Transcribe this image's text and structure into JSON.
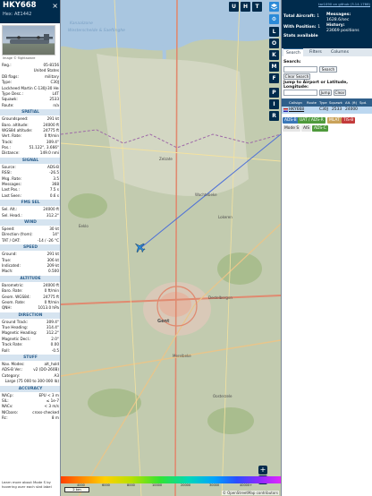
{
  "aircraft": {
    "callsign": "HKY668",
    "hex": "Hex: AE1442",
    "photo_credit": "Image © flightaware",
    "close": "×"
  },
  "basic": [
    {
      "k": "Reg.:",
      "v": "05-8156"
    },
    {
      "k": "",
      "v": "United States"
    },
    {
      "k": "DB flags:",
      "v": "military"
    },
    {
      "k": "Type:",
      "v": "C30J"
    },
    {
      "k": "",
      "v": "Lockheed Martin C-130J-30 Hercules"
    },
    {
      "k": "Type Desc.:",
      "v": "L4T"
    },
    {
      "k": "Squawk:",
      "v": "2533"
    },
    {
      "k": "Route:",
      "v": "n/a"
    }
  ],
  "sections": [
    {
      "title": "SPATIAL",
      "rows": [
        {
          "k": "Groundspeed:",
          "v": "291 kt"
        },
        {
          "k": "Baro. altitude:",
          "v": "24000 ft"
        },
        {
          "k": "WGS84 altitude:",
          "v": "24775 ft"
        },
        {
          "k": "Vert. Rate:",
          "v": "0 ft/min"
        },
        {
          "k": "Track:",
          "v": "309.4°"
        },
        {
          "k": "Pos.:",
          "v": "51.122°, 3.666°"
        },
        {
          "k": "Distance:",
          "v": "149.0 nmi"
        }
      ]
    },
    {
      "title": "SIGNAL",
      "rows": [
        {
          "k": "Source:",
          "v": "ADS-B"
        },
        {
          "k": "RSSI:",
          "v": "-26.5"
        },
        {
          "k": "Msg. Rate:",
          "v": "3.5"
        },
        {
          "k": "Messages:",
          "v": "368"
        },
        {
          "k": "Last Pos.:",
          "v": "7.5 s"
        },
        {
          "k": "Last Seen:",
          "v": "0.6 s"
        }
      ]
    },
    {
      "title": "FMS SEL",
      "rows": [
        {
          "k": "Sel. Alt.:",
          "v": "24000 ft"
        },
        {
          "k": "Sel. Head.:",
          "v": "312.2°"
        }
      ]
    },
    {
      "title": "WIND",
      "rows": [
        {
          "k": "Speed:",
          "v": "30 kt"
        },
        {
          "k": "Direction (from):",
          "v": "14°"
        },
        {
          "k": "TAT / OAT:",
          "v": "-14 / -26 °C"
        }
      ]
    },
    {
      "title": "SPEED",
      "rows": [
        {
          "k": "Ground:",
          "v": "291 kt"
        },
        {
          "k": "True:",
          "v": "306 kt"
        },
        {
          "k": "Indicated:",
          "v": "209 kt"
        },
        {
          "k": "Mach:",
          "v": "0.500"
        }
      ]
    },
    {
      "title": "ALTITUDE",
      "rows": [
        {
          "k": "Barometric:",
          "v": "24000 ft"
        },
        {
          "k": "Baro. Rate:",
          "v": "0 ft/min"
        },
        {
          "k": "Geom. WGS84:",
          "v": "24775 ft"
        },
        {
          "k": "Geom. Rate:",
          "v": "0 ft/min"
        },
        {
          "k": "QNH:",
          "v": "1013.0 hPa"
        }
      ]
    },
    {
      "title": "DIRECTION",
      "rows": [
        {
          "k": "Ground Track:",
          "v": "309.4°"
        },
        {
          "k": "True Heading:",
          "v": "314.4°"
        },
        {
          "k": "Magnetic Heading:",
          "v": "312.2°"
        },
        {
          "k": "Magnetic Decl.:",
          "v": "2.0°"
        },
        {
          "k": "Track Rate:",
          "v": "0.00"
        },
        {
          "k": "Roll:",
          "v": "-0.5"
        }
      ]
    },
    {
      "title": "STUFF",
      "rows": [
        {
          "k": "Nav. Modes:",
          "v": "alt_hold"
        },
        {
          "k": "ADS-B Ver.:",
          "v": "v2 (DO-260B)"
        },
        {
          "k": "Category:",
          "v": "A3"
        },
        {
          "k": "",
          "v": "Large (75 000 to 300 000 lb)"
        }
      ]
    },
    {
      "title": "ACCURACY",
      "rows": [
        {
          "k": "NACp:",
          "v": "EPU < 3 m"
        },
        {
          "k": "SIL:",
          "v": "≤ 1e-7"
        },
        {
          "k": "NACv:",
          "v": "< 3 m/s"
        },
        {
          "k": "NICbaro:",
          "v": "cross-checked"
        },
        {
          "k": "Rc:",
          "v": "8 m"
        }
      ]
    }
  ],
  "footer_hint": "Learn more about Mode S by hovering over each stat label",
  "map": {
    "top_buttons": [
      "U",
      "H",
      "T"
    ],
    "side_buttons": [
      "L",
      "O",
      "K",
      "M",
      "F",
      "P",
      "I",
      "R"
    ],
    "zoom_in": "+",
    "zoom_out": "−",
    "scale": "2 km",
    "labels": [
      "Kanaalzone",
      "Westerschelde & Saeftinghe",
      "Gent",
      "Lokeren",
      "Eeklo",
      "Zelzate",
      "Wachtebeke",
      "Destelbergen",
      "Merelbeke",
      "Oosterzele"
    ],
    "attribution": "© OpenStreetMap contributors",
    "altitude_ticks": [
      "4000",
      "6000",
      "8000",
      "10000",
      "20000",
      "30000",
      "40000+"
    ]
  },
  "right_panel": {
    "version_link": "tar1090 on github (3.14.1766)",
    "total_label": "Total Aircraft:",
    "total_value": "1",
    "messages_label": "Messages:",
    "messages_value": "1628.6/sec",
    "position_label": "With Position:",
    "position_value": "1",
    "history_label": "History:",
    "history_value": "23669 positions",
    "stats_label": "Stats available",
    "tabs": [
      "Search",
      "Filters",
      "Columns"
    ],
    "search_label": "Search:",
    "search_button": "Search",
    "clear_button": "Clear Search",
    "jump_label": "Jump to Airport or Latitude, Longitude:",
    "jump_button": "Jump",
    "jump_clear": "Clear",
    "columns": [
      "Callsign",
      "Route",
      "Type",
      "Squawk",
      "Alt. (ft)",
      "Spd. (kt)"
    ],
    "row": {
      "callsign": "HKY668",
      "type": "C30J",
      "squawk": "2533",
      "alt": "24000",
      "spd": ""
    },
    "badges": [
      "ADS-B",
      "UAT / ADS-R",
      "MLAT",
      "TIS-B",
      "Mode S",
      "AIS",
      "ADS-C"
    ]
  },
  "colors": {
    "header_navy": "#002b4c",
    "section_blue": "#2a5e8c",
    "aircraft_marker": "#2b8ad8",
    "track": "#4c6fd8"
  }
}
